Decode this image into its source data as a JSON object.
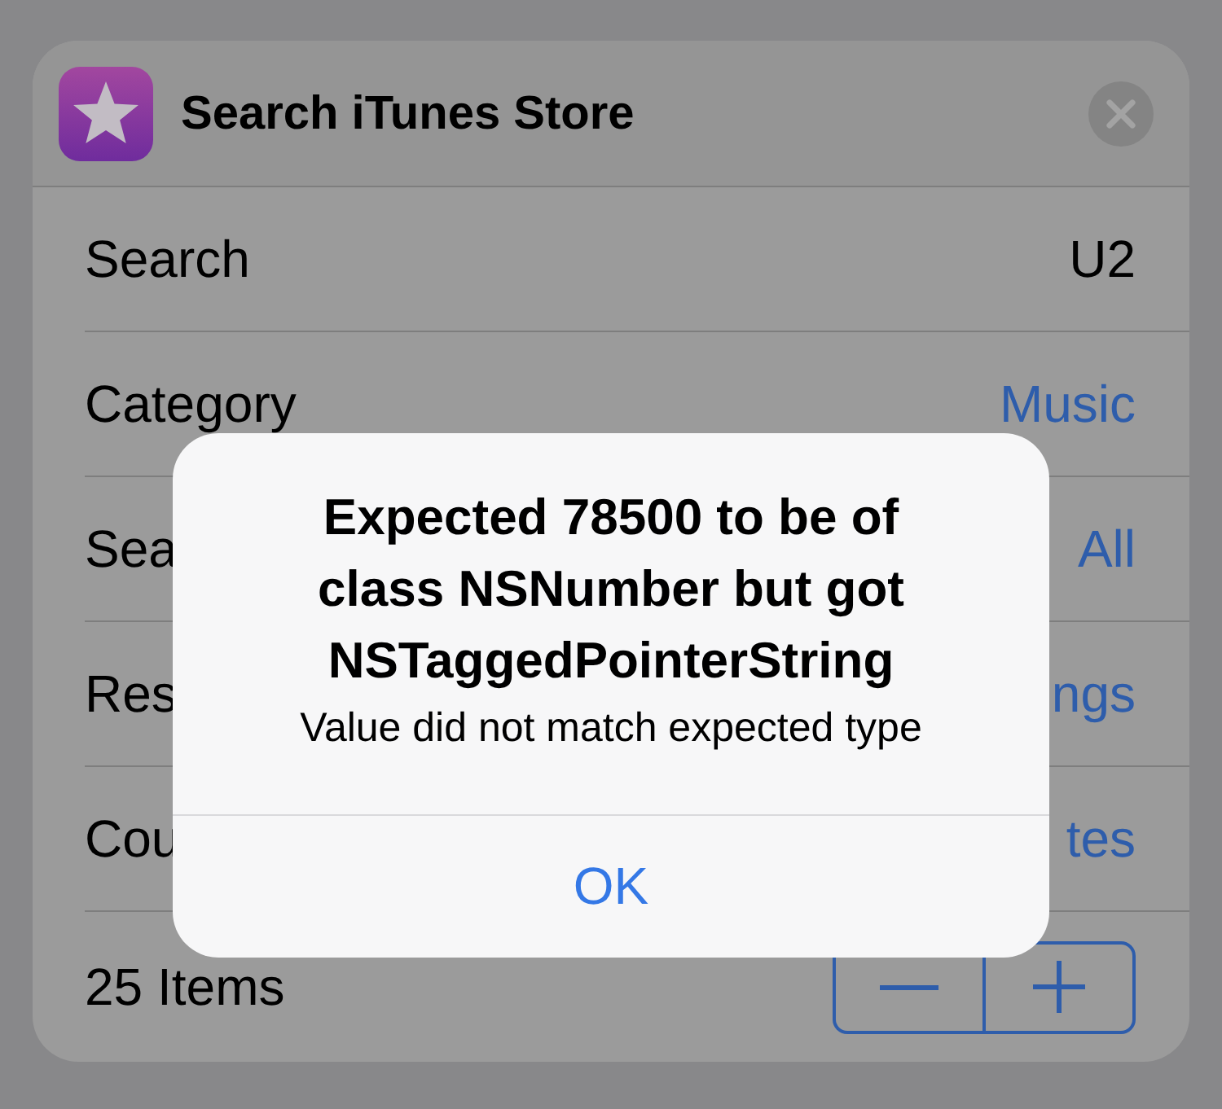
{
  "action": {
    "title": "Search iTunes Store"
  },
  "parameters": [
    {
      "kind": "text",
      "label": "Search",
      "value": "U2"
    },
    {
      "kind": "picker",
      "label": "Category",
      "value": "Music"
    },
    {
      "kind": "picker",
      "label": "Sea",
      "value": "All"
    },
    {
      "kind": "picker",
      "label": "Res",
      "value": "ngs"
    },
    {
      "kind": "picker",
      "label": "Cou",
      "value": "tes"
    },
    {
      "kind": "stepper",
      "label": "25 Items"
    }
  ],
  "alert": {
    "title": "Expected 78500 to be of class NSNumber but got NSTaggedPointerString",
    "message": "Value did not match expected type",
    "buttons": [
      "OK"
    ]
  }
}
